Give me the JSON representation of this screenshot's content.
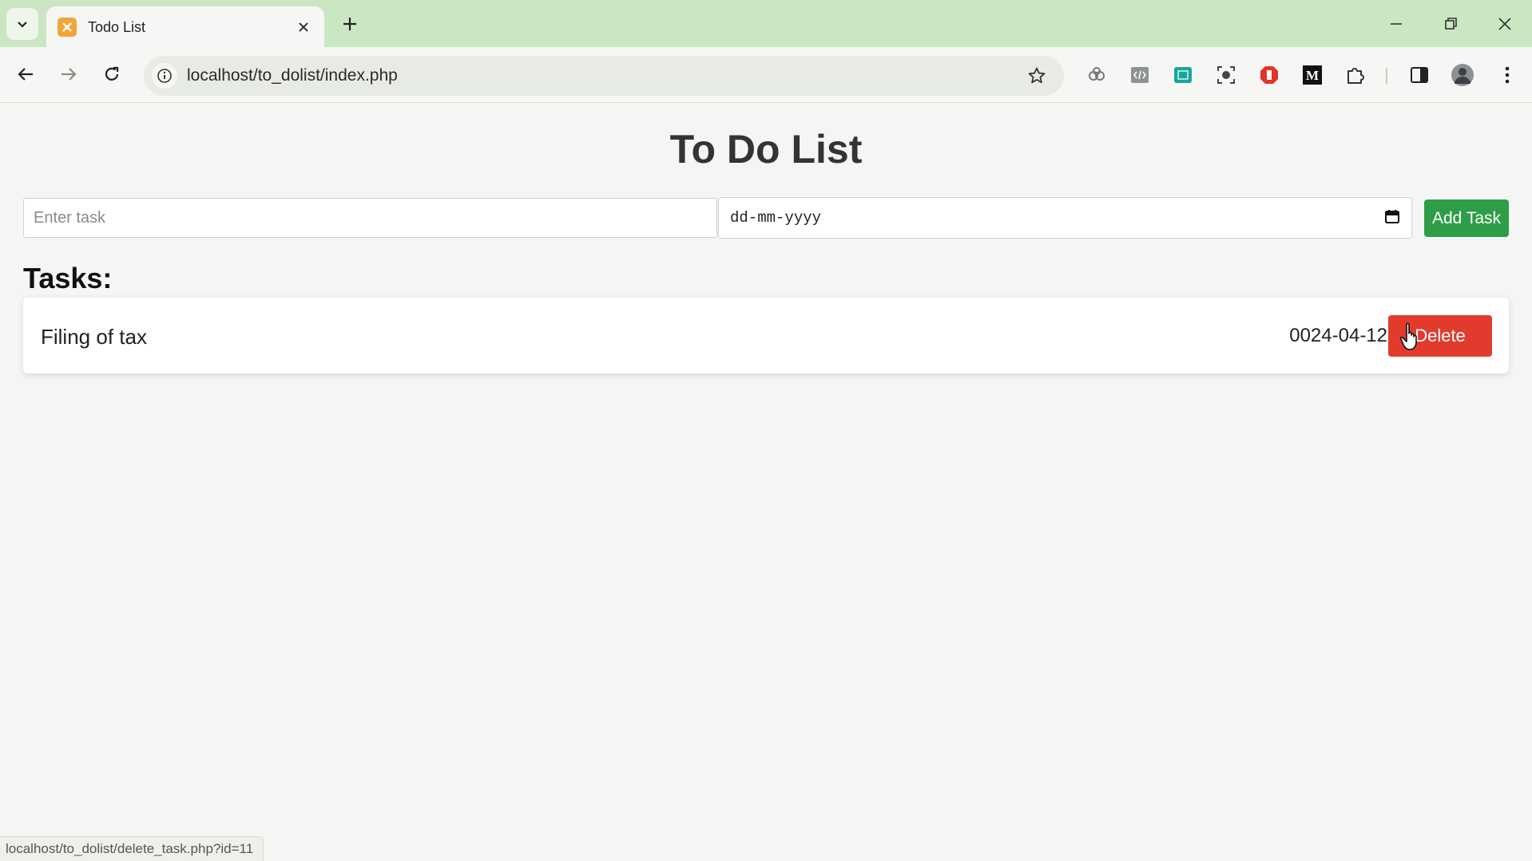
{
  "browser": {
    "tab": {
      "title": "Todo List"
    },
    "address_bar": {
      "url": "localhost/to_dolist/index.php"
    },
    "status_url": "localhost/to_dolist/delete_task.php?id=11"
  },
  "page": {
    "title": "To Do List",
    "form": {
      "task_placeholder": "Enter task",
      "task_value": "",
      "date_value": "dd-mm-yyyy",
      "add_button": "Add Task"
    },
    "tasks_heading": "Tasks:",
    "tasks": [
      {
        "name": "Filing of tax",
        "date": "0024-04-12",
        "delete_label": "Delete"
      }
    ]
  },
  "colors": {
    "tabstrip": "#cbe6c2",
    "add_button": "#2e9d48",
    "delete_button": "#e13b2e",
    "page_background": "#f4f6f3"
  },
  "icons": [
    "tab-search-icon",
    "xampp-favicon-icon",
    "close-icon",
    "plus-icon",
    "minimize-icon",
    "restore-icon",
    "window-close-icon",
    "back-arrow-icon",
    "forward-arrow-icon",
    "reload-icon",
    "site-info-icon",
    "star-icon",
    "extension-link-icon",
    "code-icon",
    "screen-capture-icon",
    "camera-lens-icon",
    "shield-icon",
    "medium-icon",
    "puzzle-icon",
    "side-panel-icon",
    "profile-avatar",
    "kebab-menu-icon",
    "calendar-icon",
    "hand-cursor-icon"
  ]
}
